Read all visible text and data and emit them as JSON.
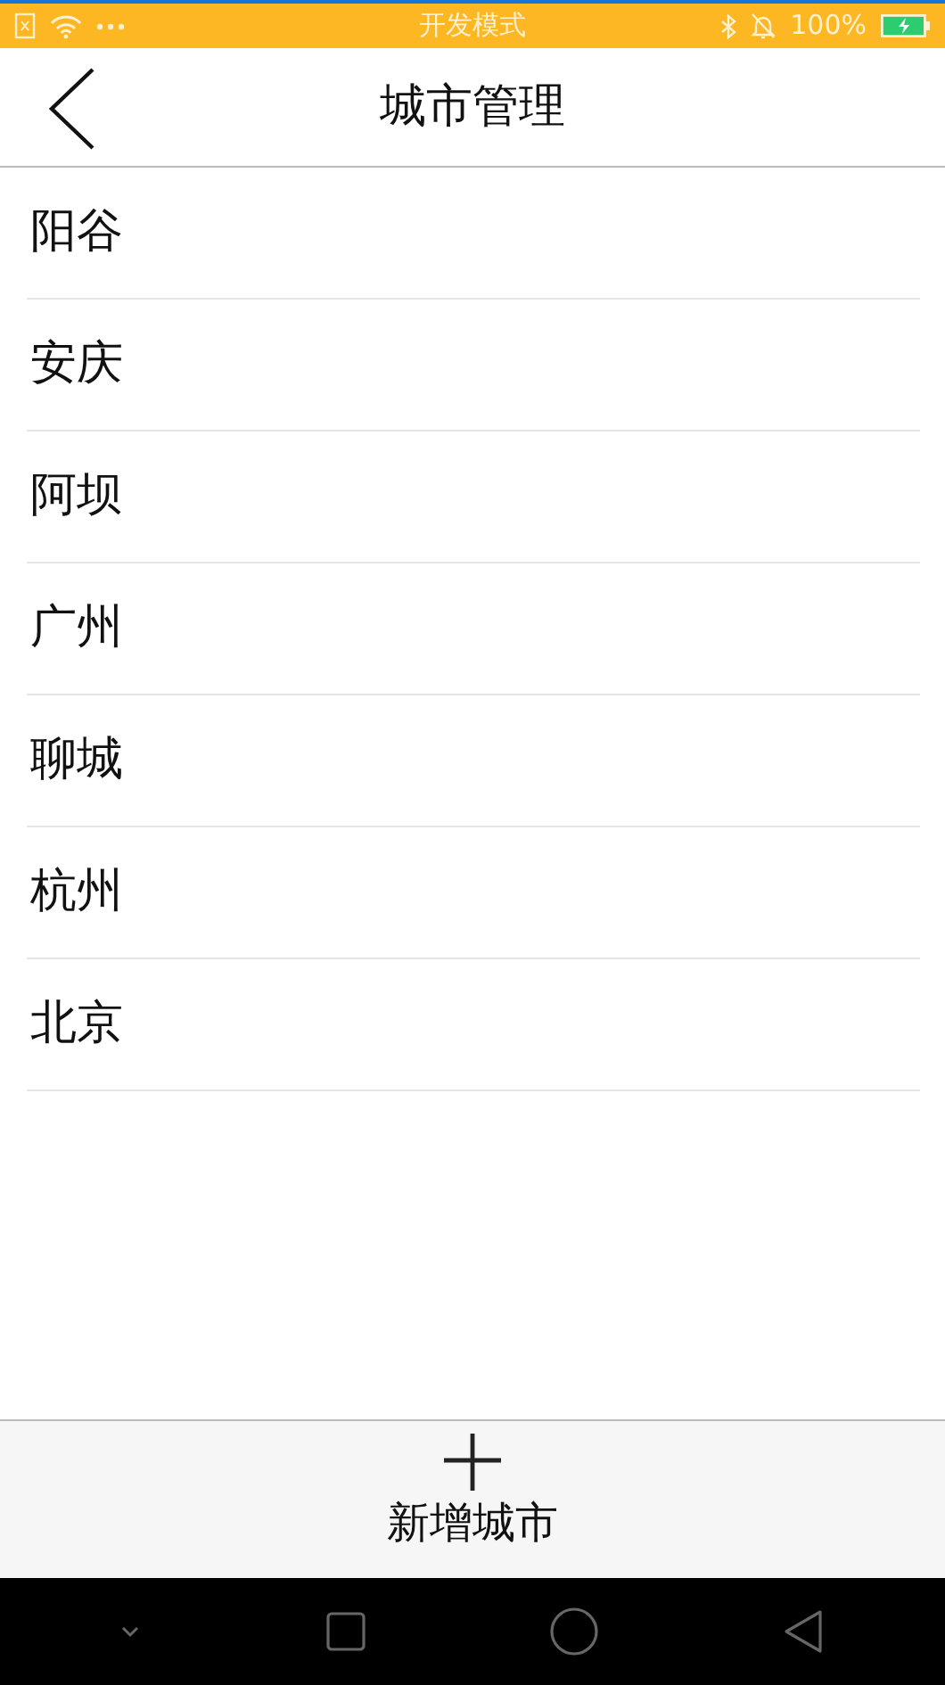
{
  "status_bar": {
    "mode": "开发模式",
    "battery": "100%"
  },
  "header": {
    "title": "城市管理"
  },
  "cities": [
    "阳谷",
    "安庆",
    "阿坝",
    "广州",
    "聊城",
    "杭州",
    "北京"
  ],
  "add_button": {
    "label": "新增城市"
  }
}
